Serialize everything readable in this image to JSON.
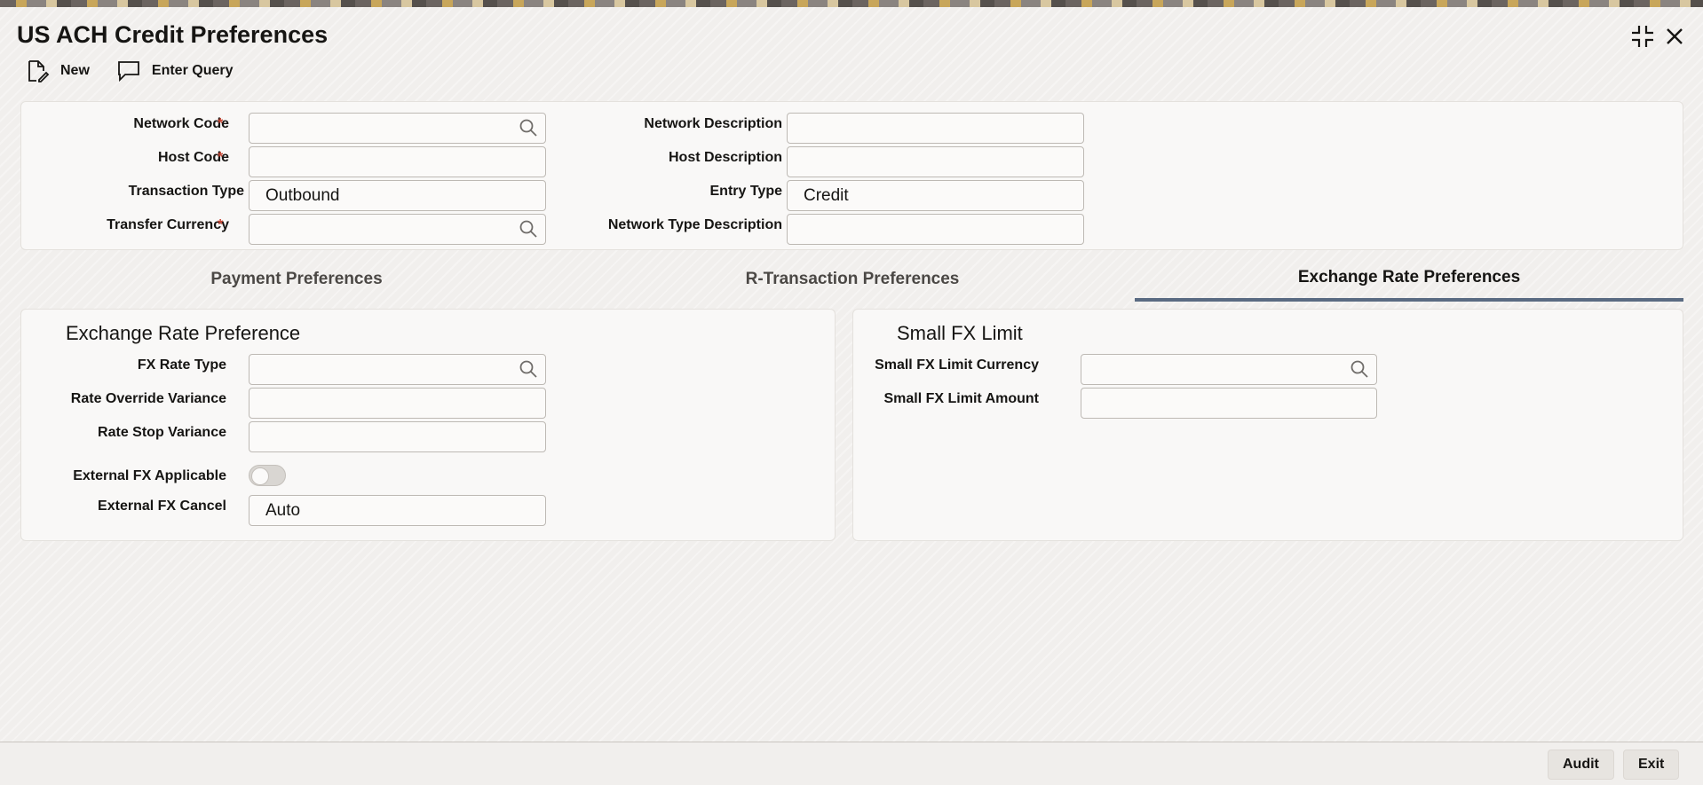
{
  "window": {
    "title": "US ACH Credit Preferences"
  },
  "toolbar": {
    "new_label": "New",
    "enter_query_label": "Enter Query"
  },
  "header_form": {
    "network_code": {
      "label": "Network Code",
      "required": "*",
      "value": ""
    },
    "host_code": {
      "label": "Host Code",
      "required": "*",
      "value": ""
    },
    "transaction_type": {
      "label": "Transaction Type",
      "value": "Outbound"
    },
    "transfer_currency": {
      "label": "Transfer Currency",
      "required": "*",
      "value": ""
    },
    "network_description": {
      "label": "Network Description",
      "value": ""
    },
    "host_description": {
      "label": "Host Description",
      "value": ""
    },
    "entry_type": {
      "label": "Entry Type",
      "value": "Credit"
    },
    "network_type_description": {
      "label": "Network Type Description",
      "value": ""
    }
  },
  "tabs": [
    {
      "label": "Payment Preferences",
      "active": false
    },
    {
      "label": "R-Transaction Preferences",
      "active": false
    },
    {
      "label": "Exchange Rate Preferences",
      "active": true
    }
  ],
  "exchange_rate_preference": {
    "heading": "Exchange Rate Preference",
    "fx_rate_type": {
      "label": "FX Rate Type",
      "value": ""
    },
    "rate_override_variance": {
      "label": "Rate Override Variance",
      "value": ""
    },
    "rate_stop_variance": {
      "label": "Rate Stop Variance",
      "value": ""
    },
    "external_fx_applicable": {
      "label": "External FX Applicable",
      "checked": false
    },
    "external_fx_cancel": {
      "label": "External FX Cancel",
      "value": "Auto"
    }
  },
  "small_fx_limit": {
    "heading": "Small FX Limit",
    "currency": {
      "label": "Small FX Limit Currency",
      "value": ""
    },
    "amount": {
      "label": "Small FX Limit Amount",
      "value": ""
    }
  },
  "footer": {
    "audit_label": "Audit",
    "exit_label": "Exit"
  },
  "colors": {
    "required": "#c74634",
    "active_tab_underline": "#5a6b82"
  }
}
